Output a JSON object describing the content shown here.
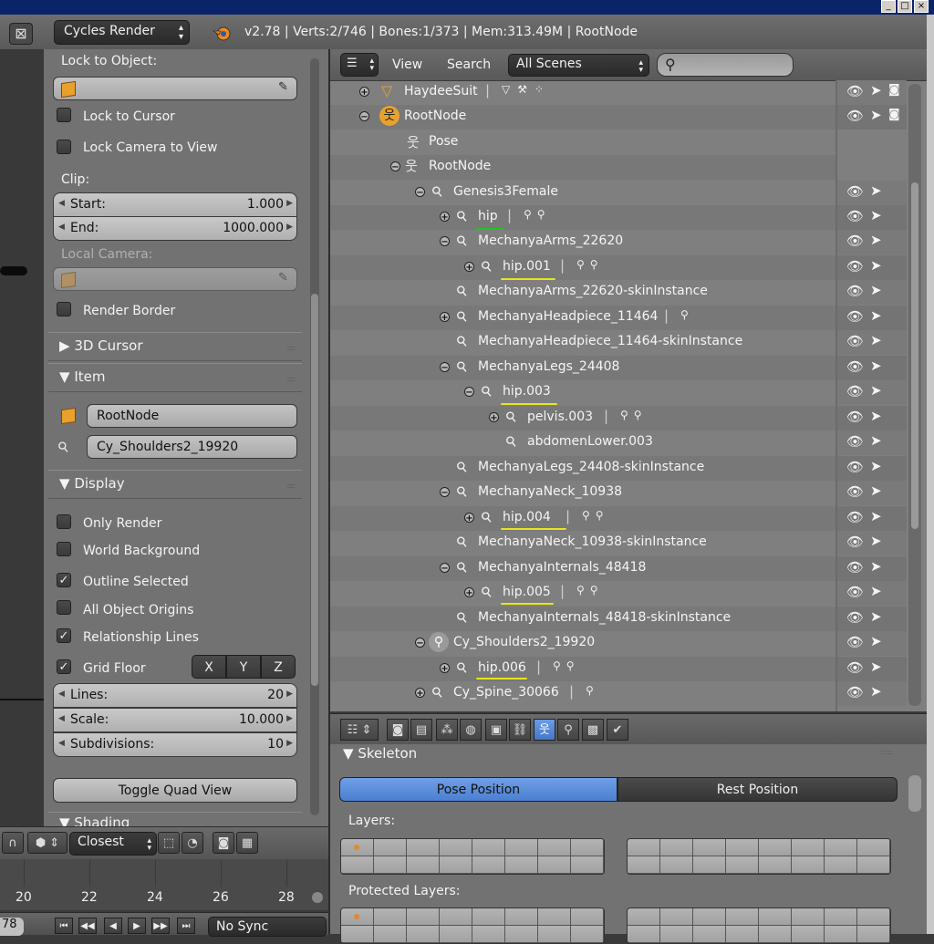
{
  "header": {
    "render_engine": "Cycles Render",
    "stats": "v2.78 | Verts:2/746 | Bones:1/373 | Mem:313.49M | RootNode"
  },
  "npanel": {
    "lock_to_object_label": "Lock to Object:",
    "lock_to_cursor": "Lock to Cursor",
    "lock_camera_to_view": "Lock Camera to View",
    "clip_label": "Clip:",
    "clip_start_label": "Start:",
    "clip_start_value": "1.000",
    "clip_end_label": "End:",
    "clip_end_value": "1000.000",
    "local_camera_label": "Local Camera:",
    "render_border": "Render Border",
    "section_3d_cursor": "3D Cursor",
    "section_item": "Item",
    "item_object_name": "RootNode",
    "item_bone_name": "Cy_Shoulders2_19920",
    "section_display": "Display",
    "display_options": [
      {
        "label": "Only Render",
        "checked": false
      },
      {
        "label": "World Background",
        "checked": false
      },
      {
        "label": "Outline Selected",
        "checked": true
      },
      {
        "label": "All Object Origins",
        "checked": false
      },
      {
        "label": "Relationship Lines",
        "checked": true
      }
    ],
    "grid_floor_label": "Grid Floor",
    "grid_floor_checked": true,
    "axes": [
      "X",
      "Y",
      "Z"
    ],
    "lines_label": "Lines:",
    "lines_value": "20",
    "scale_label": "Scale:",
    "scale_value": "10.000",
    "subdivisions_label": "Subdivisions:",
    "subdivisions_value": "10",
    "toggle_quad_view": "Toggle Quad View",
    "shading_partial": "Shading"
  },
  "viewport_toolbar": {
    "pivot": "Closest"
  },
  "timeline": {
    "ticks": [
      "20",
      "22",
      "24",
      "26",
      "28"
    ],
    "current_frame_partial": "78",
    "sync": "No Sync"
  },
  "outliner": {
    "menu_view": "View",
    "menu_search": "Search",
    "scene_filter": "All Scenes",
    "rows": [
      {
        "name": "HaydeeSuit"
      },
      {
        "name": "RootNode"
      },
      {
        "name": "Pose"
      },
      {
        "name": "RootNode"
      },
      {
        "name": "Genesis3Female"
      },
      {
        "name": "hip"
      },
      {
        "name": "MechanyaArms_22620"
      },
      {
        "name": "hip.001"
      },
      {
        "name": "MechanyaArms_22620-skinInstance"
      },
      {
        "name": "MechanyaHeadpiece_11464"
      },
      {
        "name": "MechanyaHeadpiece_11464-skinInstance"
      },
      {
        "name": "MechanyaLegs_24408"
      },
      {
        "name": "hip.003"
      },
      {
        "name": "pelvis.003"
      },
      {
        "name": "abdomenLower.003"
      },
      {
        "name": "MechanyaLegs_24408-skinInstance"
      },
      {
        "name": "MechanyaNeck_10938"
      },
      {
        "name": "hip.004"
      },
      {
        "name": "MechanyaNeck_10938-skinInstance"
      },
      {
        "name": "MechanyaInternals_48418"
      },
      {
        "name": "hip.005"
      },
      {
        "name": "MechanyaInternals_48418-skinInstance"
      },
      {
        "name": "Cy_Shoulders2_19920"
      },
      {
        "name": "hip.006"
      },
      {
        "name": "Cy_Spine_30066"
      }
    ]
  },
  "properties": {
    "panel_title": "Skeleton",
    "pose_position": "Pose Position",
    "rest_position": "Rest Position",
    "layers_label": "Layers:",
    "protected_layers_label": "Protected Layers:"
  },
  "colors": {
    "accent_blue": "#5b8fdc",
    "underline_green": "#22c222",
    "underline_yellow": "#e6e61e",
    "object_orange": "#e9a12e"
  }
}
